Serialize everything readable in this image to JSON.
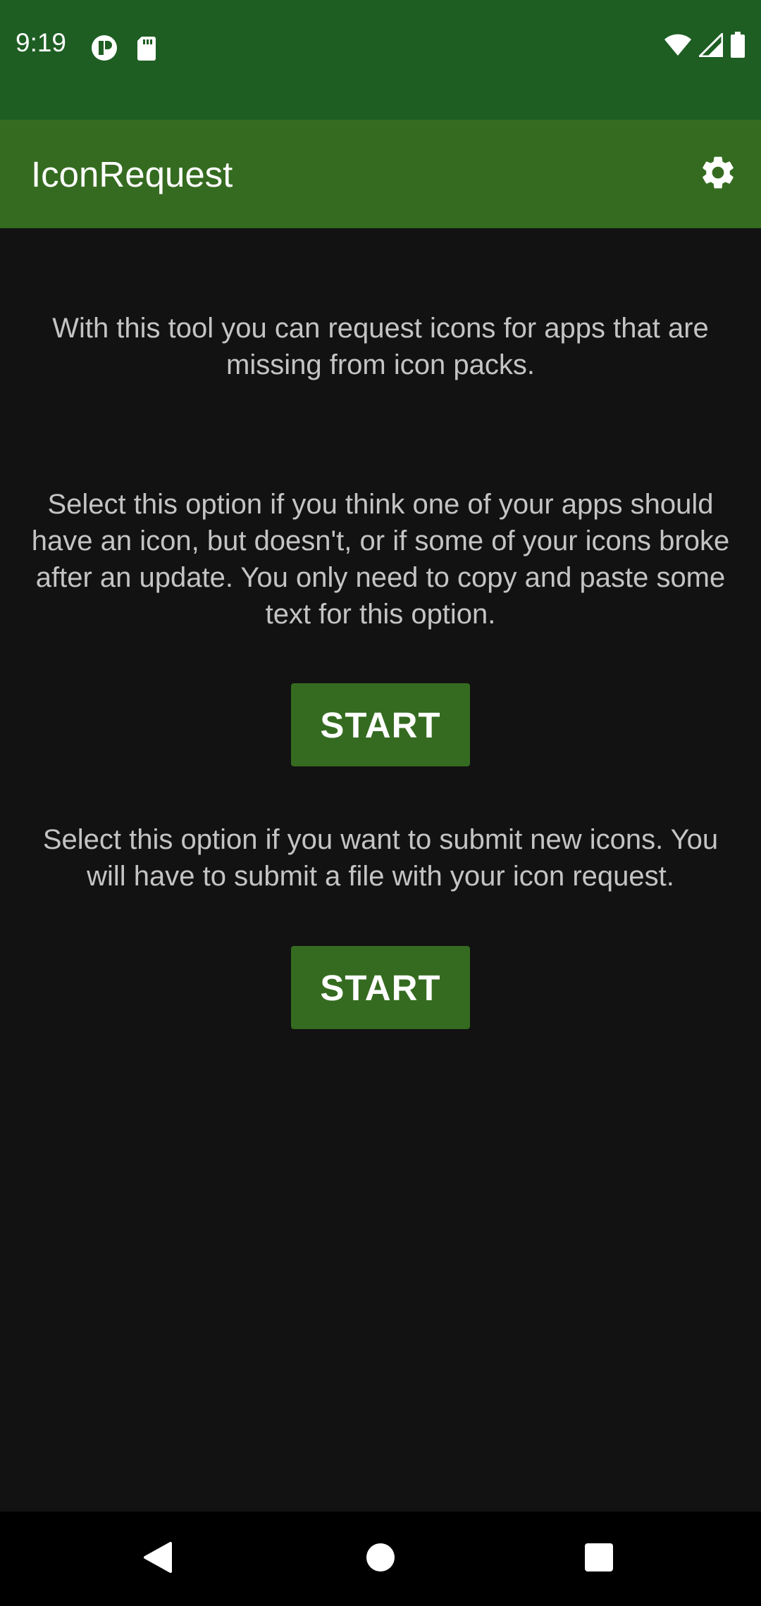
{
  "status_bar": {
    "time": "9:19",
    "icons_left": [
      "notification-app-icon",
      "sd-card-icon"
    ],
    "icons_right": [
      "wifi-icon",
      "cell-signal-icon",
      "battery-icon"
    ],
    "background_color": "#1e5e23"
  },
  "app_bar": {
    "title": "IconRequest",
    "action_icon": "gear-icon",
    "background_color": "#356b20"
  },
  "main": {
    "intro_text": "With this tool you can request icons for apps that are missing from icon packs.",
    "option1": {
      "description": "Select this option if you think one of your apps should have an icon, but doesn't, or if some of your icons broke after an update. You only need to copy and paste some text for this option.",
      "button_label": "START"
    },
    "option2": {
      "description": "Select this option if you want to submit new icons. You will have to submit a file with your icon request.",
      "button_label": "START"
    },
    "accent_color": "#356b20",
    "background_color": "#121212"
  },
  "nav_bar": {
    "buttons": [
      "back-icon",
      "home-icon",
      "recents-icon"
    ]
  }
}
